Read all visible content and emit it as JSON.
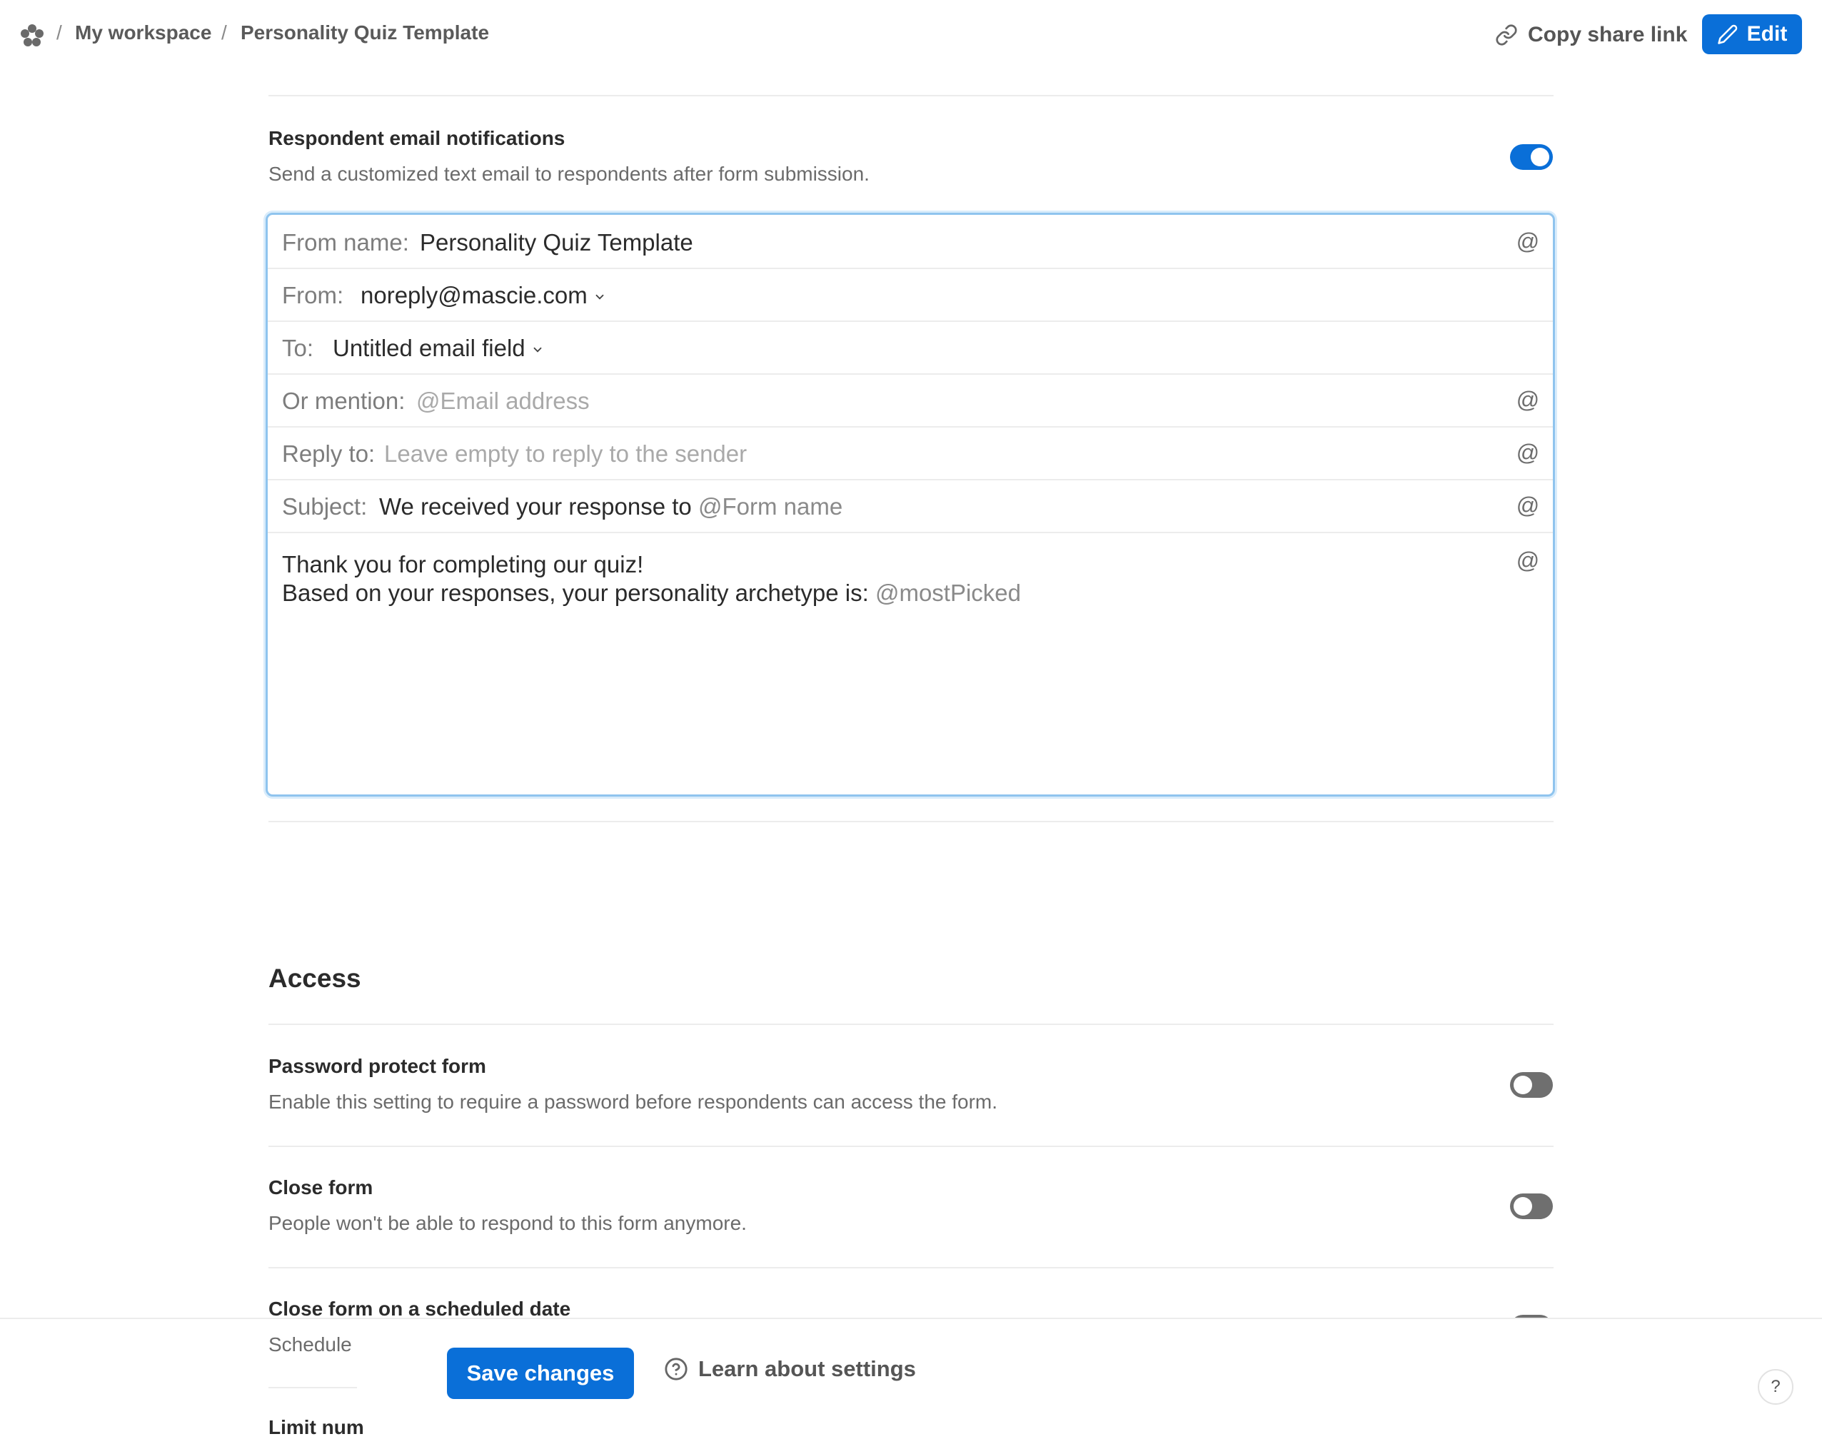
{
  "breadcrumb": {
    "separator": "/",
    "workspace": "My workspace",
    "current": "Personality Quiz Template"
  },
  "header": {
    "share_label": "Copy share link",
    "edit_label": "Edit"
  },
  "notifications": {
    "title": "Respondent email notifications",
    "description": "Send a customized text email to respondents after form submission.",
    "enabled": true
  },
  "email": {
    "from_name_label": "From name:",
    "from_name_value": "Personality Quiz Template",
    "from_label": "From:",
    "from_value": "noreply@mascie.com",
    "to_label": "To:",
    "to_value": "Untitled email field",
    "mention_label": "Or mention:",
    "mention_placeholder": "@Email address",
    "reply_label": "Reply to:",
    "reply_placeholder": "Leave empty to reply to the sender",
    "subject_label": "Subject:",
    "subject_text": "We received your response to",
    "subject_mention": "@Form name",
    "body_line1": "Thank you for completing our quiz!",
    "body_line2": "Based on your responses, your personality archetype is:",
    "body_mention": "@mostPicked",
    "mention_icon": "@"
  },
  "access": {
    "title": "Access",
    "password": {
      "title": "Password protect form",
      "description": "Enable this setting to require a password before respondents can access the form.",
      "enabled": false
    },
    "close": {
      "title": "Close form",
      "description": "People won't be able to respond to this form anymore.",
      "enabled": false
    },
    "scheduled": {
      "title": "Close form on a scheduled date",
      "description": "Schedule",
      "enabled": false
    },
    "limit_partial": "Limit num"
  },
  "footer": {
    "save_label": "Save changes",
    "learn_label": "Learn about settings",
    "help_label": "?"
  },
  "colors": {
    "accent": "#0a6fd8",
    "toggle_off": "#6f6f6f",
    "focus_ring": "#8fc4ee"
  }
}
